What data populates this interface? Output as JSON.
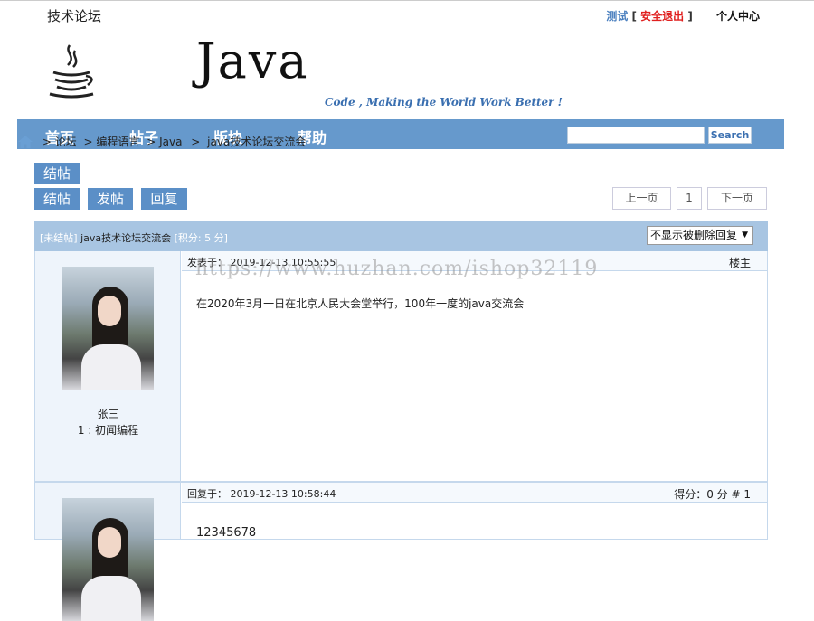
{
  "top": {
    "site_name": "技术论坛",
    "username": "测试",
    "logout": "安全退出",
    "bracket_open": "[",
    "bracket_close": "]",
    "user_center": "个人中心"
  },
  "banner": {
    "title": "Java",
    "slogan": "Code , Making the World Work Better !"
  },
  "nav": {
    "items": [
      "首页",
      "帖子",
      "版块",
      "帮助"
    ],
    "search_placeholder": "",
    "search_button": "Search"
  },
  "breadcrumb": {
    "items": [
      "> 论坛",
      "> 编程语言",
      "> Java",
      ">",
      "java技术论坛交流会"
    ]
  },
  "actions": {
    "close": "结帖",
    "post": "发帖",
    "reply": "回复"
  },
  "pagination": {
    "prev": "上一页",
    "page": "1",
    "next": "下一页"
  },
  "thread": {
    "status": "[未结帖]",
    "title": "java技术论坛交流会",
    "score": "[积分: 5 分]",
    "filter_selected": "不显示被删除回复"
  },
  "posts": [
    {
      "author": "张三",
      "level": "1 : 初闻编程",
      "meta_label": "发表于：",
      "time": "2019-12-13 10:55:55",
      "right": "楼主",
      "content": "在2020年3月一日在北京人民大会堂举行，100年一度的java交流会"
    },
    {
      "meta_label": "回复于：",
      "time": "2019-12-13 10:58:44",
      "right": "得分：0 分   # 1",
      "content": "12345678"
    }
  ],
  "watermark": "https://www.huzhan.com/ishop32119",
  "colors": {
    "nav_bg": "#6699cc",
    "button_bg": "#5b8fc7",
    "thread_head_bg": "#a8c5e2",
    "logout": "#e0201f"
  }
}
